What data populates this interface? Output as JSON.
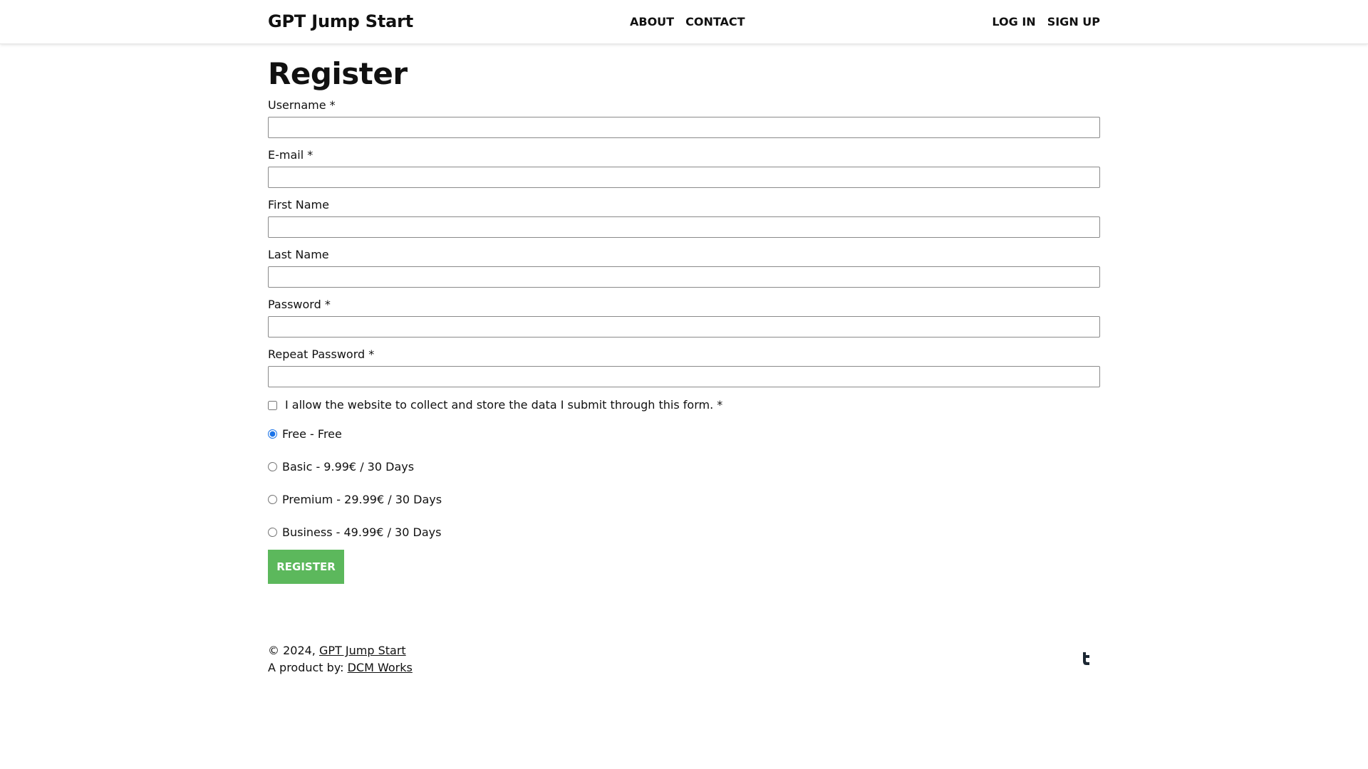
{
  "header": {
    "brand": "GPT Jump Start",
    "nav_center": [
      "ABOUT",
      "CONTACT"
    ],
    "nav_right": [
      "LOG IN",
      "SIGN UP"
    ]
  },
  "form": {
    "title": "Register",
    "fields": [
      {
        "label": "Username *",
        "value": ""
      },
      {
        "label": "E-mail *",
        "value": ""
      },
      {
        "label": "First Name",
        "value": ""
      },
      {
        "label": "Last Name",
        "value": ""
      },
      {
        "label": "Password *",
        "value": ""
      },
      {
        "label": "Repeat Password *",
        "value": ""
      }
    ],
    "consent_label": "I allow the website to collect and store the data I submit through this form. *",
    "consent_checked": false,
    "plans": [
      {
        "label": "Free - Free",
        "selected": true
      },
      {
        "label": "Basic - 9.99€ / 30 Days",
        "selected": false
      },
      {
        "label": "Premium - 29.99€ / 30 Days",
        "selected": false
      },
      {
        "label": "Business - 49.99€ / 30 Days",
        "selected": false
      }
    ],
    "submit_label": "REGISTER",
    "submit_color": "#5cb85c"
  },
  "footer": {
    "copyright_prefix": "© 2024,",
    "copyright_link": "GPT Jump Start",
    "product_prefix": "A product by:",
    "product_link": "DCM Works",
    "social_icon": "twitter-icon"
  }
}
